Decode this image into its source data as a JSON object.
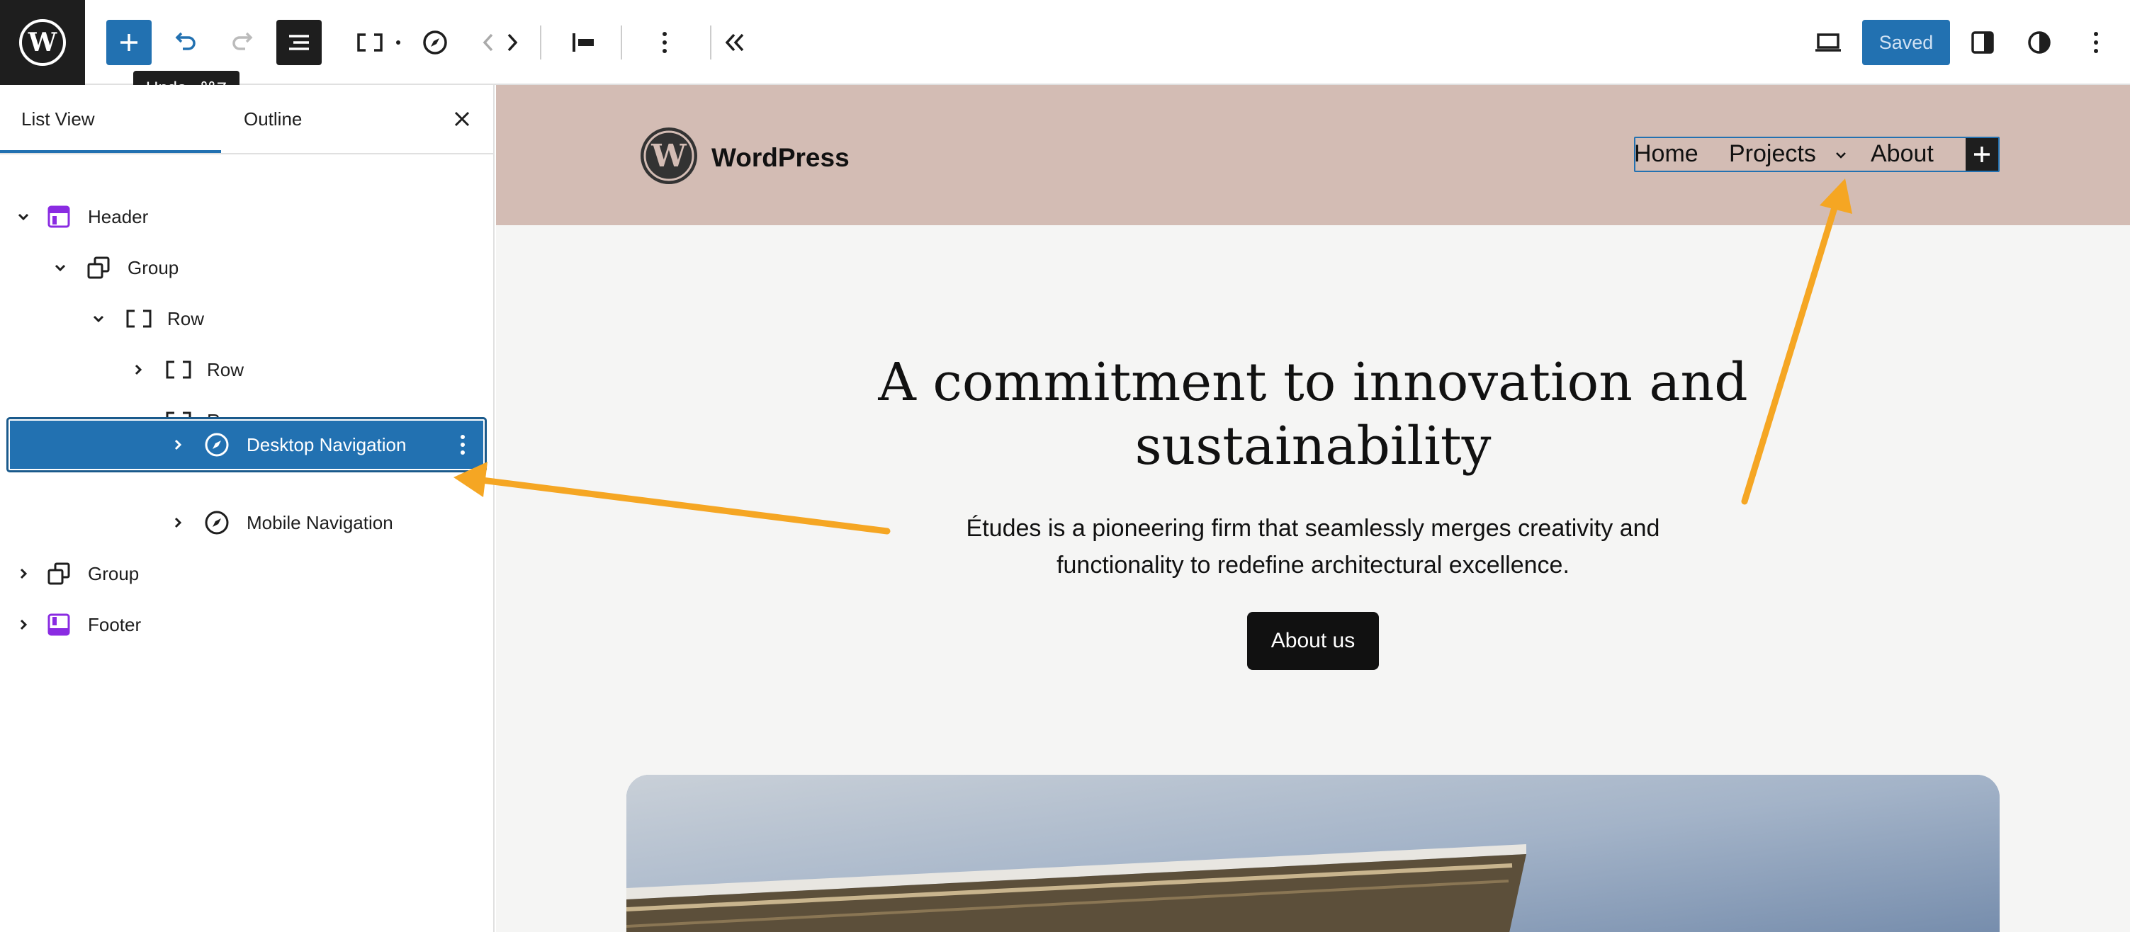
{
  "toolbar": {
    "tooltip_label": "Undo",
    "tooltip_shortcut": "⌘Z",
    "saved_label": "Saved"
  },
  "sidebar": {
    "tabs": [
      {
        "label": "List View",
        "active": true
      },
      {
        "label": "Outline",
        "active": false
      }
    ],
    "tree": [
      {
        "label": "Header",
        "icon": "template-part-header-icon",
        "expanded": true
      },
      {
        "label": "Group",
        "icon": "group-icon",
        "expanded": true
      },
      {
        "label": "Row",
        "icon": "row-icon",
        "expanded": true
      },
      {
        "label": "Row",
        "icon": "row-icon",
        "expanded": false
      },
      {
        "label": "Row",
        "icon": "row-icon",
        "expanded": true
      },
      {
        "label": "Desktop Navigation",
        "icon": "navigation-icon",
        "expanded": false,
        "selected": true
      },
      {
        "label": "Mobile Navigation",
        "icon": "navigation-icon",
        "expanded": false
      },
      {
        "label": "Group",
        "icon": "group-icon",
        "expanded": false
      },
      {
        "label": "Footer",
        "icon": "template-part-footer-icon",
        "expanded": false
      }
    ]
  },
  "canvas": {
    "site_title": "WordPress",
    "nav": {
      "items": [
        "Home",
        "Projects",
        "About"
      ]
    },
    "heading_line1": "A commitment to innovation and",
    "heading_line2": "sustainability",
    "paragraph_line1": "Études is a pioneering firm that seamlessly merges creativity and",
    "paragraph_line2": "functionality to redefine architectural excellence.",
    "button_label": "About us"
  },
  "colors": {
    "accent": "#2271b1",
    "header_bg": "#d3bcb4",
    "annotation_arrow": "#f5a623",
    "canvas_bg": "#f5f5f4"
  }
}
